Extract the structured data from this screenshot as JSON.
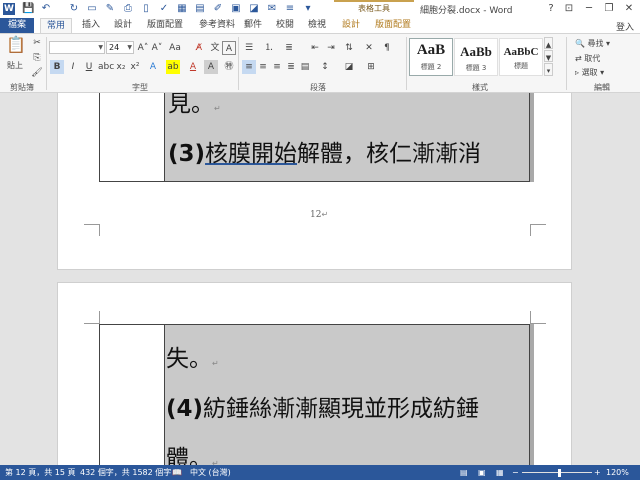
{
  "window": {
    "title": "細胞分裂.docx - Word",
    "context_group": "表格工具",
    "min": "─",
    "restore": "❐",
    "close": "✕",
    "help": "?"
  },
  "quick_access": {
    "word_icon": "W",
    "save": "💾",
    "undo": "↶",
    "redo": "↻"
  },
  "tabs": {
    "file": "檔案",
    "home": "常用",
    "insert": "插入",
    "design": "設計",
    "layout": "版面配置",
    "references": "參考資料",
    "mailings": "郵件",
    "review": "校閱",
    "view": "檢視",
    "table_design": "設計",
    "table_layout": "版面配置",
    "login": "登入"
  },
  "ribbon": {
    "clipboard": {
      "paste": "貼上",
      "label": "剪貼簿"
    },
    "font": {
      "name": "",
      "size": "24",
      "bold": "B",
      "italic": "I",
      "underline": "U",
      "label": "字型"
    },
    "paragraph": {
      "label": "段落"
    },
    "styles": {
      "items": [
        {
          "sample": "AaB",
          "name": "標題 2"
        },
        {
          "sample": "AaBb",
          "name": "標題 3"
        },
        {
          "sample": "AaBbC",
          "name": "標題"
        }
      ],
      "label": "樣式"
    },
    "editing": {
      "find": "尋找",
      "replace": "取代",
      "select": "選取",
      "label": "編輯"
    }
  },
  "document": {
    "page1": {
      "line1": "見。",
      "line2_num": "(3)",
      "line2_underlined": "核膜開始",
      "line2_rest": "解體，核仁漸漸消",
      "page_number": "12"
    },
    "page2": {
      "line1": "失。",
      "line2_num": "(4)",
      "line2_rest": "紡錘絲漸漸顯現並形成紡錘",
      "line3": "體。"
    },
    "para_mark": "↵"
  },
  "status": {
    "page": "第 12 頁，共 15 頁",
    "words": "432 個字，共 1582 個字",
    "language": "中文 (台灣)",
    "zoom": "120%"
  }
}
